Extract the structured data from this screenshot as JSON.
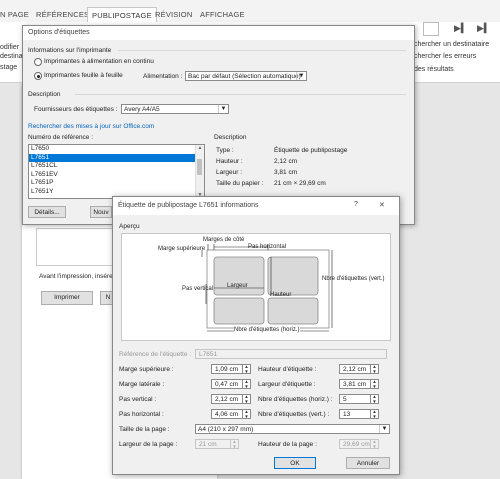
{
  "ribbon": {
    "tabs": [
      "N PAGE",
      "RÉFÉRENCES",
      "PUBLIPOSTAGE",
      "RÉVISION",
      "AFFICHAGE"
    ],
    "active_tab": "PUBLIPOSTAGE",
    "left_labels": [
      "odifier",
      "destinat",
      "stage"
    ],
    "right_labels": [
      "chercher un destinataire",
      "chercher les erreurs",
      "des résultats"
    ]
  },
  "page_behind": {
    "text": "Avant l'impression, insére",
    "print_button": "Imprimer",
    "n_button": "N"
  },
  "dialog1": {
    "title": "Options d'étiquettes",
    "printer_info_label": "Informations sur l'imprimante",
    "radio_continuous": "Imprimantes à alimentation en continu",
    "radio_sheet": "Imprimantes feuille à feuille",
    "feed_label": "Alimentation :",
    "feed_value": "Bac par défaut (Sélection automatique)",
    "description_group": "Description",
    "supplier_label": "Fournisseurs des étiquettes :",
    "supplier_value": "Avery A4/A5",
    "update_link": "Rechercher des mises à jour sur Office.com",
    "ref_number_label": "Numéro de référence :",
    "list_items": [
      "L7650",
      "L7651",
      "L7651CL",
      "L7651EV",
      "L7651P",
      "L7651Y"
    ],
    "selected_item": "L7651",
    "desc_label": "Description",
    "desc_rows": [
      {
        "k": "Type :",
        "v": "Étiquette de publipostage"
      },
      {
        "k": "Hauteur :",
        "v": "2,12 cm"
      },
      {
        "k": "Largeur :",
        "v": "3,81 cm"
      },
      {
        "k": "Taille du papier :",
        "v": "21 cm × 29,69 cm"
      }
    ],
    "details_button": "Détails...",
    "new_button": "Nouv"
  },
  "dialog2": {
    "title": "Étiquette de publipostage L7651 informations",
    "help": "?",
    "close": "✕",
    "preview_label": "Aperçu",
    "preview": {
      "side_margins": "Marges de côté",
      "top_margin": "Marge supérieure",
      "horiz_pitch": "Pas horizontal",
      "vert_pitch": "Pas vertical",
      "width": "Largeur",
      "height": "Hauteur",
      "n_across": "Nbre d'étiquettes (horiz.)",
      "n_down": "Nbre d'étiquettes (vert.)"
    },
    "ref_label": "Référence de l'étiquette :",
    "ref_value": "L7651",
    "fields_left": [
      {
        "label": "Marge supérieure :",
        "value": "1,09 cm"
      },
      {
        "label": "Marge latérale :",
        "value": "0,47 cm"
      },
      {
        "label": "Pas vertical :",
        "value": "2,12 cm"
      },
      {
        "label": "Pas horizontal :",
        "value": "4,06 cm"
      }
    ],
    "fields_right": [
      {
        "label": "Hauteur d'étiquette :",
        "value": "2,12 cm"
      },
      {
        "label": "Largeur d'étiquette :",
        "value": "3,81 cm"
      },
      {
        "label": "Nbre d'étiquettes (horiz.) :",
        "value": "5"
      },
      {
        "label": "Nbre d'étiquettes (vert.) :",
        "value": "13"
      }
    ],
    "page_size_label": "Taille de la page :",
    "page_size_value": "A4 (210 x 297 mm)",
    "page_width_label": "Largeur de la page :",
    "page_width_value": "21 cm",
    "page_height_label": "Hauteur de la page :",
    "page_height_value": "29,69 cm",
    "ok": "OK",
    "cancel": "Annuler"
  }
}
